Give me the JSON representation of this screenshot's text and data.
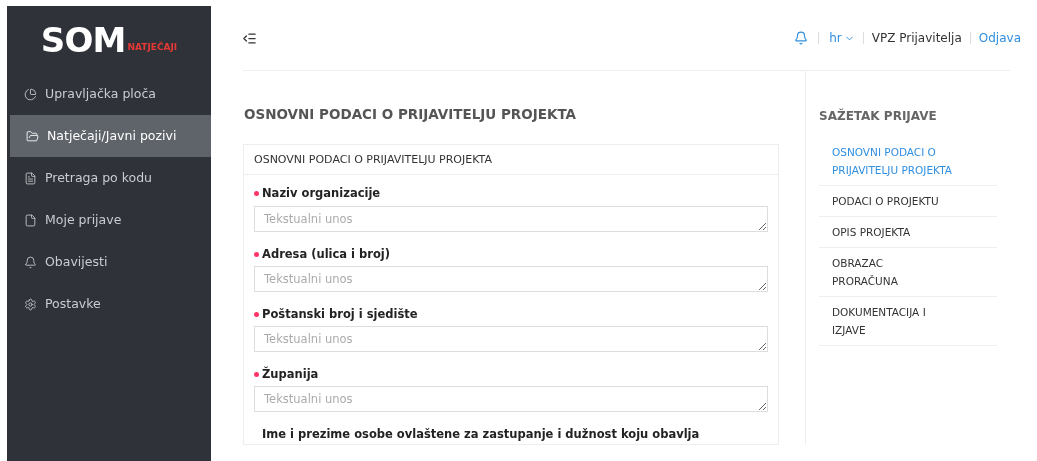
{
  "logo": {
    "text": "SOM",
    "subtitle": "NATJEČAJI"
  },
  "sidebar": {
    "items": [
      {
        "label": "Upravljačka ploča",
        "selected": false
      },
      {
        "label": "Natječaji/Javni pozivi",
        "selected": true
      },
      {
        "label": "Pretraga po kodu",
        "selected": false
      },
      {
        "label": "Moje prijave",
        "selected": false
      },
      {
        "label": "Obavijesti",
        "selected": false
      },
      {
        "label": "Postavke",
        "selected": false
      }
    ]
  },
  "header": {
    "language": "hr",
    "user": "VPZ Prijavitelja",
    "logout": "Odjava"
  },
  "main": {
    "title": "OSNOVNI PODACI O PRIJAVITELJU PROJEKTA",
    "card": {
      "title": "OSNOVNI PODACI O PRIJAVITELJU PROJEKTA",
      "fields": [
        {
          "label": "Naziv organizacije",
          "required": true,
          "placeholder": "Tekstualni unos"
        },
        {
          "label": "Adresa (ulica i broj)",
          "required": true,
          "placeholder": "Tekstualni unos"
        },
        {
          "label": "Poštanski broj i sjedište",
          "required": true,
          "placeholder": "Tekstualni unos"
        },
        {
          "label": "Županija",
          "required": true,
          "placeholder": "Tekstualni unos"
        }
      ],
      "next_label": "Ime i prezime osobe ovlaštene za zastupanje i dužnost koju obavlja"
    }
  },
  "summary": {
    "title": "SAŽETAK PRIJAVE",
    "items": [
      {
        "label": "OSNOVNI PODACI O PRIJAVITELJU PROJEKTA",
        "selected": true
      },
      {
        "label": "PODACI O PROJEKTU",
        "selected": false
      },
      {
        "label": "OPIS PROJEKTA",
        "selected": false
      },
      {
        "label": "OBRAZAC PRORAČUNA",
        "selected": false
      },
      {
        "label": "DOKUMENTACIJA I IZJAVE",
        "selected": false
      }
    ]
  }
}
